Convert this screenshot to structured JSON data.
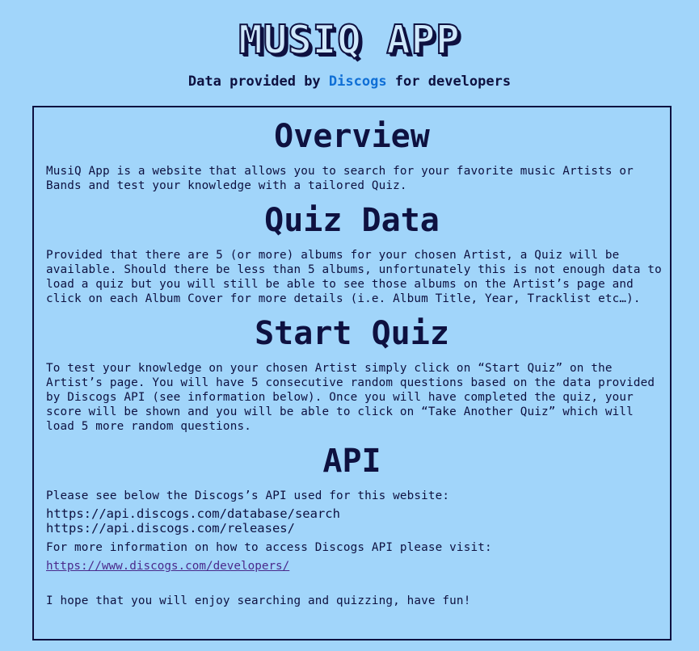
{
  "header": {
    "app_title": "MUSIQ APP",
    "subtitle_prefix": "Data provided by ",
    "subtitle_brand": "Discogs",
    "subtitle_suffix": " for developers"
  },
  "sections": {
    "overview": {
      "heading": "Overview",
      "text": "MusiQ App is a website that allows you to search for your favorite music Artists or Bands and test your knowledge with a tailored Quiz."
    },
    "quiz_data": {
      "heading": "Quiz Data",
      "text": "Provided that there are 5 (or more) albums for your chosen Artist, a Quiz will be available. Should there be less than 5 albums, unfortunately this is not enough data to load a quiz but you will still be able to see those albums on the Artist’s page and click on each Album Cover for more details (i.e. Album Title, Year, Tracklist etc…)."
    },
    "start_quiz": {
      "heading": "Start Quiz",
      "text": "To test your knowledge on your chosen Artist simply click on “Start Quiz” on the Artist’s page. You will have 5 consecutive random questions based on the data provided by Discogs API (see information below). Once you will have completed the quiz, your score will be shown and you will be able to click on “Take Another Quiz” which will load 5 more random questions."
    },
    "api": {
      "heading": "API",
      "intro": "Please see below the Discogs’s API used for this website:",
      "endpoints": [
        "https://api.discogs.com/database/search",
        "https://api.discogs.com/releases/"
      ],
      "access_text": "For more information on how to access Discogs API please visit:",
      "link": "https://www.discogs.com/developers/",
      "closing": "I hope that you will enjoy searching and quizzing, have fun!"
    }
  }
}
